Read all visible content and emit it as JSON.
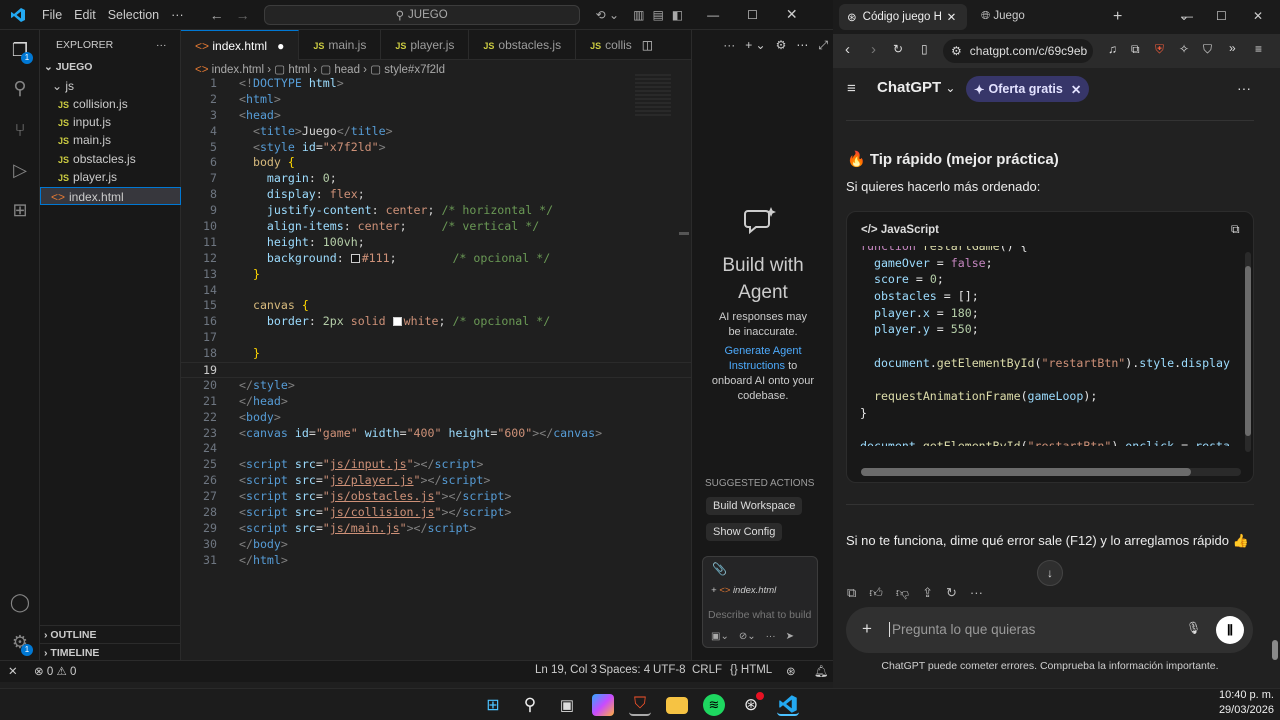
{
  "vscode": {
    "menu": [
      "File",
      "Edit",
      "Selection"
    ],
    "search_text": "JUEGO",
    "explorer_title": "EXPLORER",
    "folder": "JUEGO",
    "subfolder": "js",
    "files_js": [
      "collision.js",
      "input.js",
      "main.js",
      "obstacles.js",
      "player.js"
    ],
    "file_html": "index.html",
    "outline": "OUTLINE",
    "timeline": "TIMELINE",
    "tabs": [
      "index.html",
      "main.js",
      "player.js",
      "obstacles.js",
      "collis"
    ],
    "breadcrumb": [
      "index.html",
      "html",
      "head",
      "style#x7f2ld"
    ],
    "line_numbers": [
      "1",
      "2",
      "3",
      "4",
      "5",
      "6",
      "7",
      "8",
      "9",
      "10",
      "11",
      "12",
      "13",
      "14",
      "15",
      "16",
      "17",
      "18",
      "19",
      "20",
      "21",
      "22",
      "23",
      "24",
      "25",
      "26",
      "27",
      "28",
      "29",
      "30",
      "31"
    ],
    "agent": {
      "title": "Build with Agent",
      "disclaimer": "AI responses may be inaccurate.",
      "link": "Generate Agent Instructions",
      "link_rest": "to onboard AI onto your codebase.",
      "suggested": "SUGGESTED ACTIONS",
      "btn1": "Build Workspace",
      "btn2": "Show Config",
      "context_file": "index.html",
      "input_placeholder": "Describe what to build"
    },
    "status": {
      "errors": "0",
      "warnings": "0",
      "position": "Ln 19, Col 3",
      "spaces": "Spaces: 4",
      "encoding": "UTF-8",
      "eol": "CRLF",
      "language": "HTML"
    },
    "badges": {
      "explorer": "1",
      "settings": "1"
    }
  },
  "browser": {
    "tab1": "Código juego H",
    "tab2": "Juego",
    "url": "chatgpt.com/c/69c9eb",
    "app_title": "ChatGPT",
    "offer": "Oferta gratis",
    "heading": "🔥 Tip rápido (mejor práctica)",
    "intro": "Si quieres hacerlo más ordenado:",
    "code_lang": "JavaScript",
    "code_lines": [
      "function restartGame() {",
      "  gameOver = false;",
      "  score = 0;",
      "  obstacles = [];",
      "  player.x = 180;",
      "  player.y = 550;",
      "",
      "  document.getElementById(\"restartBtn\").style.display = \"none\";",
      "",
      "  requestAnimationFrame(gameLoop);",
      "}",
      "",
      "document.getElementById(\"restartBtn\").onclick = restartGame;"
    ],
    "followup": "Si no te funciona, dime qué error sale (F12) y lo arreglamos rápido 👍",
    "input_placeholder": "Pregunta lo que quieras",
    "footer": "ChatGPT puede cometer errores. Comprueba la información importante."
  },
  "taskbar": {
    "time": "10:40 p. m.",
    "date": "29/03/2026"
  }
}
